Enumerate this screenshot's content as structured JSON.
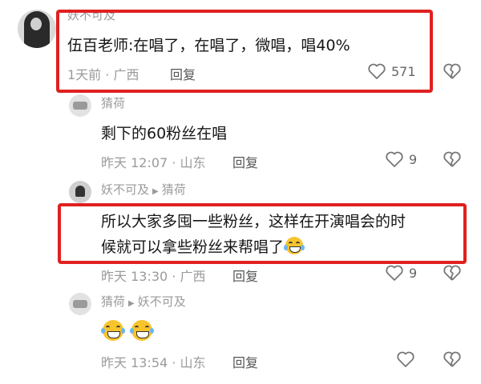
{
  "comments": [
    {
      "username": "妖不可及",
      "text": "伍百老师:在唱了，在唱了，微唱，唱40%",
      "time": "1天前",
      "location": "广西",
      "reply_label": "回复",
      "likes": "571"
    },
    {
      "username": "猜荷",
      "text": "剩下的60粉丝在唱",
      "time": "昨天 12:07",
      "location": "山东",
      "reply_label": "回复",
      "likes": "9"
    },
    {
      "username": "妖不可及",
      "reply_to": "猜荷",
      "text_line1": "所以大家多囤一些粉丝，这样在开演唱会的时",
      "text_line2": "候就可以拿些粉丝来帮唱了",
      "time": "昨天 13:30",
      "location": "广西",
      "reply_label": "回复",
      "likes": "9"
    },
    {
      "username": "猜荷",
      "reply_to": "妖不可及",
      "time": "昨天 13:54",
      "location": "山东",
      "reply_label": "回复"
    }
  ],
  "meta_separator": " · ",
  "colors": {
    "highlight": "#e02020",
    "meta_gray": "#9a9a9a"
  },
  "icons": [
    "heart-icon",
    "broken-heart-icon",
    "laughing-tears-emoji",
    "reply-arrow-icon"
  ]
}
